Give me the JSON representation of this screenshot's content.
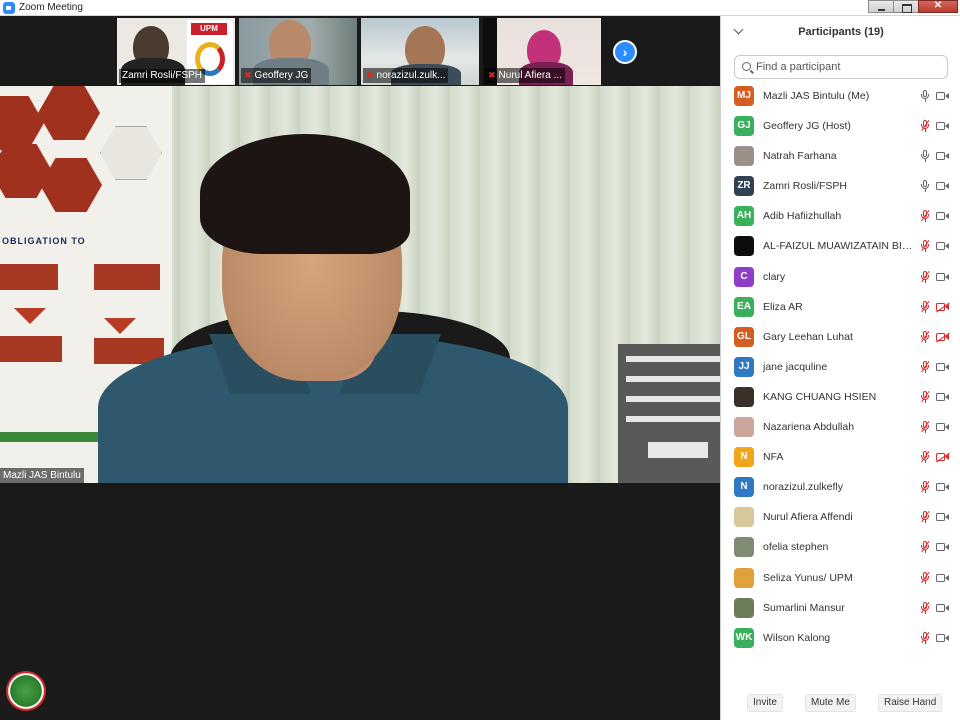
{
  "window": {
    "title": "Zoom Meeting"
  },
  "strip": {
    "tiles": [
      {
        "name": "Zamri Rosli/FSPH",
        "muted": false,
        "poster_logo": "UPM"
      },
      {
        "name": "Geoffery JG",
        "muted": true
      },
      {
        "name": "norazizul.zulk...",
        "muted": true
      },
      {
        "name": "Nurul Afiera ...",
        "muted": true
      }
    ],
    "next_icon": "chevron-right-icon"
  },
  "main_video": {
    "name": "Mazli JAS Bintulu",
    "poster_heading": "OBLIGATION TO"
  },
  "panel": {
    "title": "Participants (19)",
    "search_placeholder": "Find a participant",
    "participants": [
      {
        "name": "Mazli JAS Bintulu (Me)",
        "initials": "MJ",
        "color": "#d45d1f",
        "mic": "on",
        "cam": "on"
      },
      {
        "name": "Geoffery JG (Host)",
        "initials": "GJ",
        "color": "#3bb05a",
        "mic": "off",
        "cam": "on"
      },
      {
        "name": "Natrah Farhana",
        "initials": "",
        "color": "#9b8f8a",
        "mic": "on",
        "cam": "on"
      },
      {
        "name": "Zamri Rosli/FSPH",
        "initials": "ZR",
        "color": "#2f4152",
        "mic": "on",
        "cam": "on"
      },
      {
        "name": "Adib Hafiizhullah",
        "initials": "AH",
        "color": "#3bb05a",
        "mic": "off",
        "cam": "on"
      },
      {
        "name": "AL-FAIZUL MUAWIZATAIN BIN AB...",
        "initials": "",
        "color": "#0d0d0d",
        "mic": "off",
        "cam": "on"
      },
      {
        "name": "clary",
        "initials": "C",
        "color": "#8e3dc7",
        "mic": "off",
        "cam": "on"
      },
      {
        "name": "Eliza AR",
        "initials": "EA",
        "color": "#3bb05a",
        "mic": "off",
        "cam": "off"
      },
      {
        "name": "Gary Leehan Luhat",
        "initials": "GL",
        "color": "#d45d1f",
        "mic": "off",
        "cam": "off"
      },
      {
        "name": "jane jacquline",
        "initials": "JJ",
        "color": "#2f78c4",
        "mic": "off",
        "cam": "on"
      },
      {
        "name": "KANG CHUANG HSIEN",
        "initials": "",
        "color": "#3a3028",
        "mic": "off",
        "cam": "on"
      },
      {
        "name": "Nazariena Abdullah",
        "initials": "",
        "color": "#caa79a",
        "mic": "off",
        "cam": "on"
      },
      {
        "name": "NFA",
        "initials": "N",
        "color": "#f2a51a",
        "mic": "off",
        "cam": "off"
      },
      {
        "name": "norazizul.zulkefly",
        "initials": "N",
        "color": "#2f78c4",
        "mic": "off",
        "cam": "on"
      },
      {
        "name": "Nurul Afiera Affendi",
        "initials": "",
        "color": "#d8c79a",
        "mic": "off",
        "cam": "on"
      },
      {
        "name": "ofelia stephen",
        "initials": "",
        "color": "#7f8c73",
        "mic": "off",
        "cam": "on"
      },
      {
        "name": "Seliza Yunus/ UPM",
        "initials": "",
        "color": "#e0a23a",
        "mic": "off",
        "cam": "on"
      },
      {
        "name": "Sumarlini Mansur",
        "initials": "",
        "color": "#6c7f5a",
        "mic": "off",
        "cam": "on"
      },
      {
        "name": "Wilson Kalong",
        "initials": "WK",
        "color": "#3bb05a",
        "mic": "off",
        "cam": "on"
      }
    ],
    "footer": {
      "invite": "Invite",
      "mute_me": "Mute Me",
      "raise_hand": "Raise Hand"
    }
  }
}
